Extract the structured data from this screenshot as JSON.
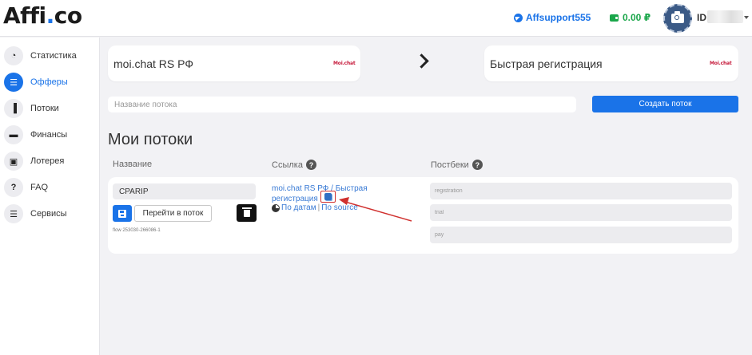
{
  "header": {
    "logo_main": "Affi",
    "logo_dot": ".",
    "logo_tail": "co",
    "telegram_label": "Affsupport555",
    "balance": "0.00 ₽",
    "user_id_label": "ID"
  },
  "sidebar": {
    "items": [
      {
        "label": "Статистика",
        "icon": "pie-chart-icon",
        "glyph": "◔"
      },
      {
        "label": "Офферы",
        "icon": "list-icon",
        "glyph": "☰",
        "active": true
      },
      {
        "label": "Потоки",
        "icon": "flows-icon",
        "glyph": "▐"
      },
      {
        "label": "Финансы",
        "icon": "wallet-icon",
        "glyph": "▬"
      },
      {
        "label": "Лотерея",
        "icon": "gift-icon",
        "glyph": "▣"
      },
      {
        "label": "FAQ",
        "icon": "question-icon",
        "glyph": "?"
      },
      {
        "label": "Сервисы",
        "icon": "services-list-icon",
        "glyph": "☰"
      }
    ]
  },
  "offer": {
    "left_title": "moi.chat RS РФ",
    "left_logo": "Moi.chat",
    "right_title": "Быстрая регистрация",
    "right_logo": "Moi.chat"
  },
  "create_stream": {
    "placeholder": "Название потока",
    "button_label": "Создать поток"
  },
  "my_streams": {
    "title": "Мои потоки",
    "col_name": "Название",
    "col_link": "Ссылка",
    "col_postbacks": "Постбеки",
    "help_glyph": "?"
  },
  "stream_row": {
    "name_value": "CPARIP",
    "go_button": "Перейти в поток",
    "flow_id": "flow 253030-266086-1",
    "link_text": "moi.chat RS РФ / Быстрая регистрация",
    "by_dates": "По датам",
    "separator": "|",
    "by_source": "По source",
    "postbacks": [
      {
        "placeholder": "registration"
      },
      {
        "placeholder": "trial"
      },
      {
        "placeholder": "pay"
      }
    ]
  },
  "colors": {
    "accent": "#1a73e8",
    "balance_green": "#1aa64a",
    "annotation_red": "#d0302e"
  }
}
